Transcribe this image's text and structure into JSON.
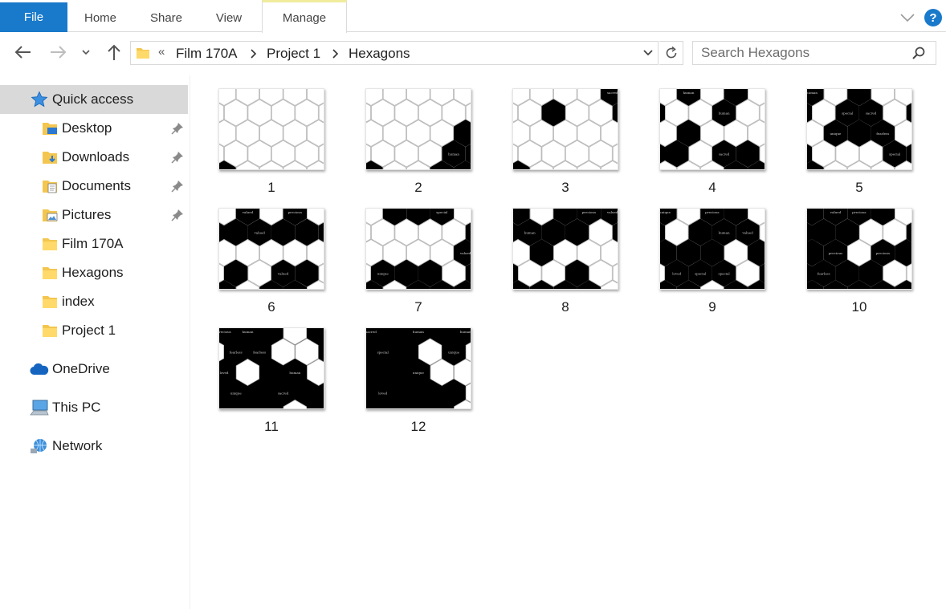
{
  "ribbon": {
    "tabs": [
      {
        "label": "File"
      },
      {
        "label": "Home"
      },
      {
        "label": "Share"
      },
      {
        "label": "View"
      },
      {
        "label": "Manage"
      }
    ],
    "help_label": "?"
  },
  "address": {
    "overflow_marker": "«",
    "crumbs": [
      "Film 170A",
      "Project 1",
      "Hexagons"
    ]
  },
  "search": {
    "placeholder": "Search Hexagons"
  },
  "sidebar": {
    "quick_access": "Quick access",
    "items": [
      {
        "label": "Desktop",
        "icon": "desktop-folder-icon",
        "pinned": true
      },
      {
        "label": "Downloads",
        "icon": "downloads-folder-icon",
        "pinned": true
      },
      {
        "label": "Documents",
        "icon": "documents-folder-icon",
        "pinned": true
      },
      {
        "label": "Pictures",
        "icon": "pictures-folder-icon",
        "pinned": true
      },
      {
        "label": "Film 170A",
        "icon": "folder-icon",
        "pinned": false
      },
      {
        "label": "Hexagons",
        "icon": "folder-icon",
        "pinned": false
      },
      {
        "label": "index",
        "icon": "folder-icon",
        "pinned": false
      },
      {
        "label": "Project 1",
        "icon": "folder-icon",
        "pinned": false
      }
    ],
    "onedrive": "OneDrive",
    "this_pc": "This PC",
    "network": "Network"
  },
  "files": [
    {
      "name": "1"
    },
    {
      "name": "2"
    },
    {
      "name": "3"
    },
    {
      "name": "4"
    },
    {
      "name": "5"
    },
    {
      "name": "6"
    },
    {
      "name": "7"
    },
    {
      "name": "8"
    },
    {
      "name": "9"
    },
    {
      "name": "10"
    },
    {
      "name": "11"
    },
    {
      "name": "12"
    }
  ],
  "colors": {
    "accent": "#1979ca",
    "selected": "#d9d9d9",
    "manage_tab_highlight": "#f1ec9c",
    "folder": "#f3c64f"
  }
}
